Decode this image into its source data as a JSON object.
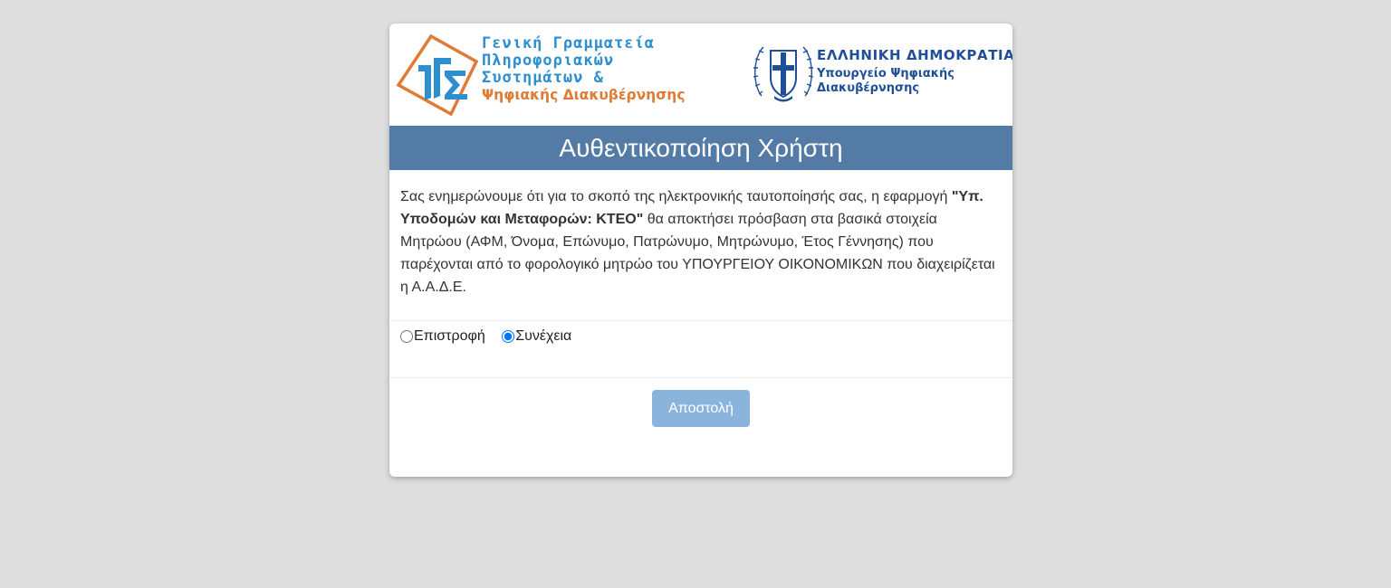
{
  "colors": {
    "page_bg": "#dedede",
    "banner_bg": "#547ba5",
    "gsis_blue": "#2e8fd0",
    "gsis_orange": "#e07b36",
    "hr_blue": "#1f4f97",
    "button_bg": "#8bb4dc"
  },
  "logos": {
    "gsis": {
      "icon": "gsis-logo-icon",
      "line1": "Γενική Γραμματεία",
      "line2": "Πληροφοριακών",
      "line3": "Συστημάτων &",
      "line4": "Ψηφιακής Διακυβέρνησης"
    },
    "hellenic_republic": {
      "icon": "greek-emblem-icon",
      "title": "ΕΛΛΗΝΙΚΗ ΔΗΜΟΚΡΑΤΙΑ",
      "subtitle_line1": "Υπουργείο Ψηφιακής",
      "subtitle_line2": "Διακυβέρνησης"
    }
  },
  "banner": {
    "title": "Αυθεντικοποίηση Χρήστη"
  },
  "info": {
    "part1": "Σας ενημερώνουμε ότι για το σκοπό της ηλεκτρονικής ταυτοποίησής σας, η εφαρμογή ",
    "app_name": "\"Υπ. Υποδομών και Μεταφορών: ΚΤΕΟ\"",
    "part2": " θα αποκτήσει πρόσβαση στα βασικά στοιχεία Μητρώου (ΑΦΜ, Όνομα, Επώνυμο, Πατρώνυμο, Μητρώνυμο, Έτος Γέννησης) που παρέχονται από το φορολογικό μητρώο του ΥΠΟΥΡΓΕΙΟΥ ΟΙΚΟΝΟΜΙΚΩΝ που διαχειρίζεται η Α.Α.Δ.Ε."
  },
  "choices": {
    "back_label": "Επιστροφή",
    "continue_label": "Συνέχεια",
    "selected": "continue"
  },
  "actions": {
    "submit_label": "Αποστολή"
  }
}
